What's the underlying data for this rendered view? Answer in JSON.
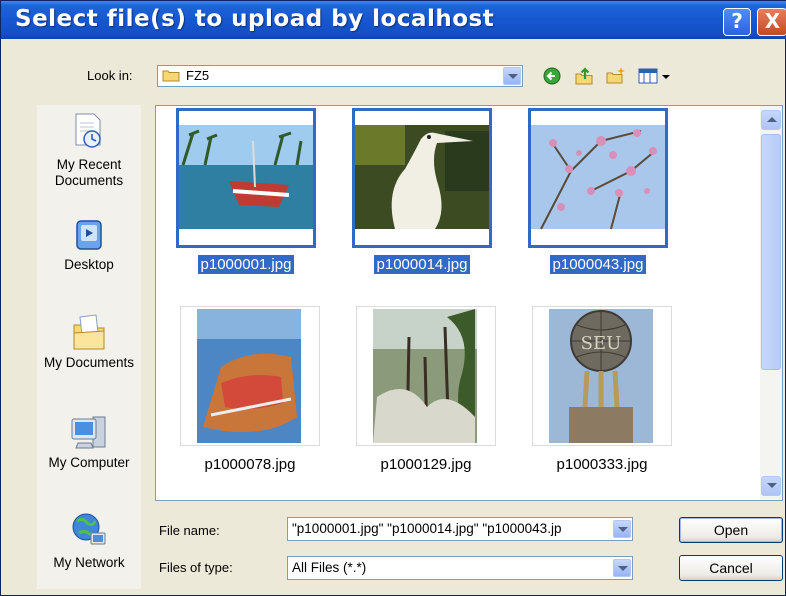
{
  "window": {
    "title": "Select file(s) to upload by localhost",
    "help_label": "?",
    "close_label": "X"
  },
  "lookin": {
    "label": "Look in:",
    "value": "FZ5"
  },
  "toolbar": {
    "icons": [
      "back-icon",
      "up-folder-icon",
      "new-folder-icon",
      "view-menu-icon"
    ]
  },
  "places": [
    {
      "label": "My Recent Documents",
      "icon": "recent-documents-icon"
    },
    {
      "label": "Desktop",
      "icon": "desktop-icon"
    },
    {
      "label": "My Documents",
      "icon": "my-documents-icon"
    },
    {
      "label": "My Computer",
      "icon": "my-computer-icon"
    },
    {
      "label": "My Network",
      "icon": "my-network-icon"
    }
  ],
  "files": [
    {
      "name": "p1000001.jpg",
      "selected": true
    },
    {
      "name": "p1000014.jpg",
      "selected": true
    },
    {
      "name": "p1000043.jpg",
      "selected": true
    },
    {
      "name": "p1000078.jpg",
      "selected": false
    },
    {
      "name": "p1000129.jpg",
      "selected": false
    },
    {
      "name": "p1000333.jpg",
      "selected": false
    }
  ],
  "filename": {
    "label": "File name:",
    "value": "\"p1000001.jpg\" \"p1000014.jpg\" \"p1000043.jp"
  },
  "filetype": {
    "label": "Files of type:",
    "value": "All Files (*.*)"
  },
  "buttons": {
    "open": "Open",
    "cancel": "Cancel"
  },
  "colors": {
    "title_bar": "#1657d0",
    "selection": "#316ac5",
    "dialog_bg": "#ece9d8"
  }
}
